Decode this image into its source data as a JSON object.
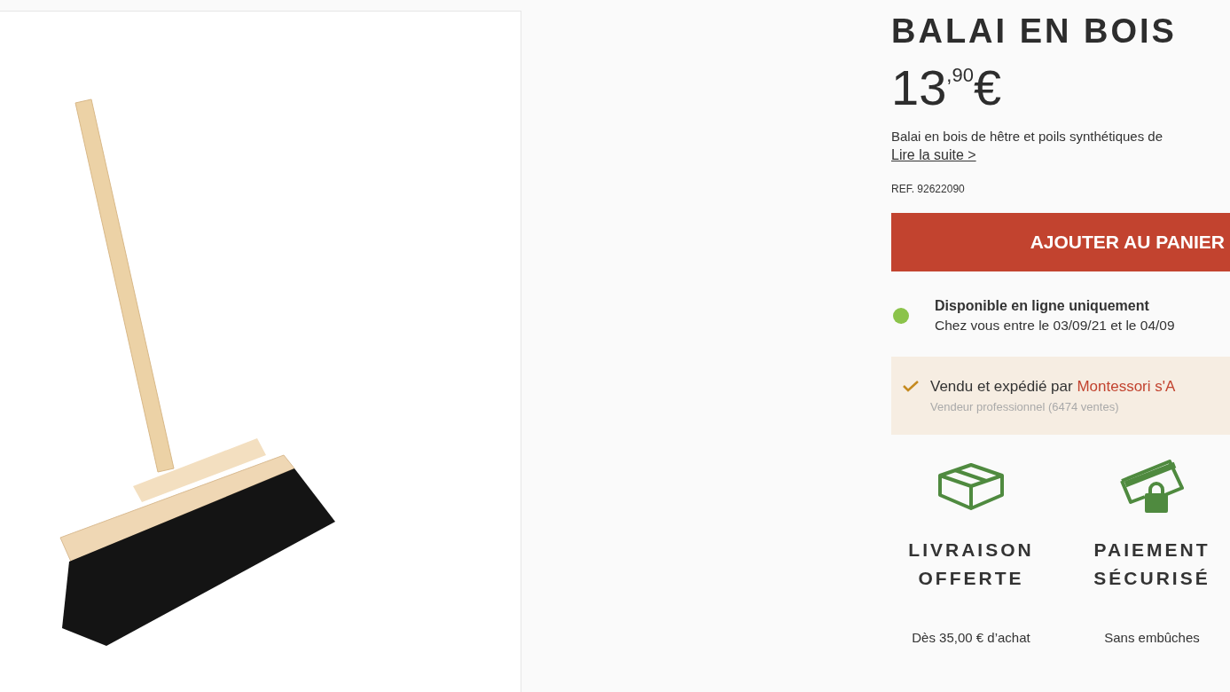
{
  "product": {
    "title": "BALAI EN BOIS",
    "price": "13$^{,90}$€",
    "description": "Balai en bois de hêtre et poils synthétiques de",
    "read_more": "Lire la suite >",
    "reference": "REF. 92622090"
  },
  "add_to_cart": "AJOUTER AU PANIER",
  "availability": {
    "available": true,
    "title": "Disponible en ligne uniquement",
    "delivery": "Chez vous entre le 03/09/21 et le 04/09"
  },
  "seller": {
    "sold_by": "Vendu et expédié par",
    "name": "Montessori s'A",
    "details": "Vendeur professionnel (6474 ventes)"
  },
  "features": [
    {
      "kind": "box",
      "title": "LIVRAISON OFFERTE",
      "subtitle": "Dès 35,00 € d’achat"
    },
    {
      "kind": "card",
      "title": "PAIEMENT SÉCURISÉ",
      "subtitle": "Sans embûches"
    }
  ]
}
